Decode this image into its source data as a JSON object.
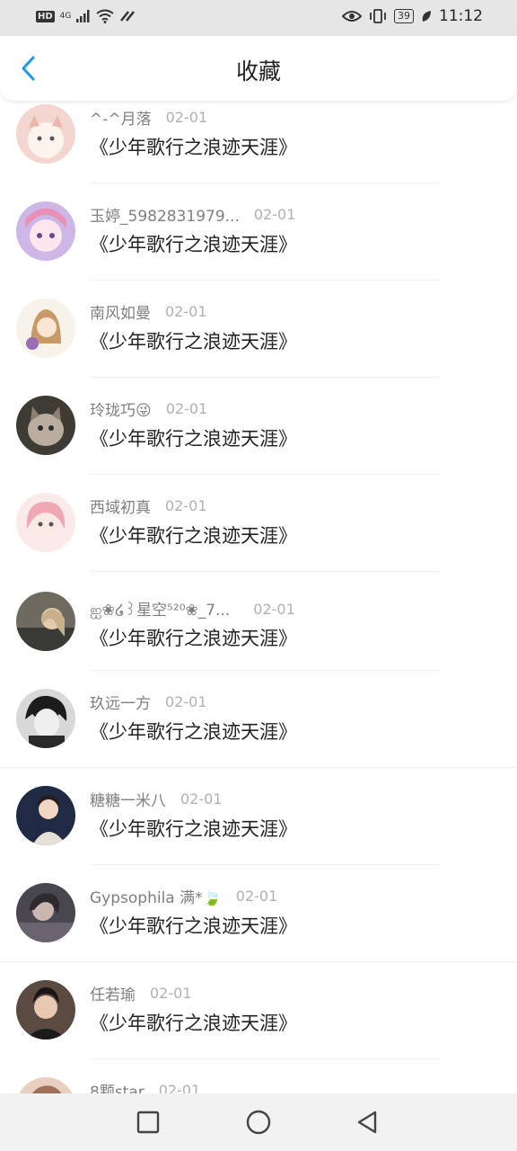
{
  "status_bar": {
    "network": "HD",
    "signal": "4G",
    "battery": "39",
    "time": "11:12",
    "icons": [
      "hd-icon",
      "signal-icon",
      "wifi-icon",
      "eye-icon",
      "vibrate-icon",
      "battery-icon",
      "leaf-icon"
    ]
  },
  "header": {
    "title": "收藏",
    "back_icon": "chevron-left-icon"
  },
  "items": [
    {
      "name": "^-^月落",
      "date": "02-01",
      "content": "《少年歌行之浪迹天涯》"
    },
    {
      "name": "玉婷_5982831979...",
      "date": "02-01",
      "content": "《少年歌行之浪迹天涯》"
    },
    {
      "name": "南风如曼",
      "date": "02-01",
      "content": "《少年歌行之浪迹天涯》"
    },
    {
      "name": "玲珑巧😜",
      "date": "02-01",
      "content": "《少年歌行之浪迹天涯》"
    },
    {
      "name": "西域初真",
      "date": "02-01",
      "content": "《少年歌行之浪迹天涯》"
    },
    {
      "name": "ஐ❀໒꒱星空⁵²⁰❀_7...",
      "date": "02-01",
      "content": "《少年歌行之浪迹天涯》"
    },
    {
      "name": "玖远一方",
      "date": "02-01",
      "content": "《少年歌行之浪迹天涯》"
    },
    {
      "name": "糖糖一米八",
      "date": "02-01",
      "content": "《少年歌行之浪迹天涯》"
    },
    {
      "name": "Gypsophila 满*🍃",
      "date": "02-01",
      "content": "《少年歌行之浪迹天涯》"
    },
    {
      "name": "任若瑜",
      "date": "02-01",
      "content": "《少年歌行之浪迹天涯》"
    },
    {
      "name": "8颗star",
      "date": "02-01",
      "content": ""
    }
  ],
  "nav_bar": {
    "buttons": [
      "recent-apps",
      "home",
      "back"
    ]
  },
  "colors": {
    "accent": "#1e9be8",
    "status_bar_bg": "#e6e6e6",
    "name_text": "#7f7f7f",
    "date_text": "#b0b0b0",
    "content_text": "#222222"
  }
}
